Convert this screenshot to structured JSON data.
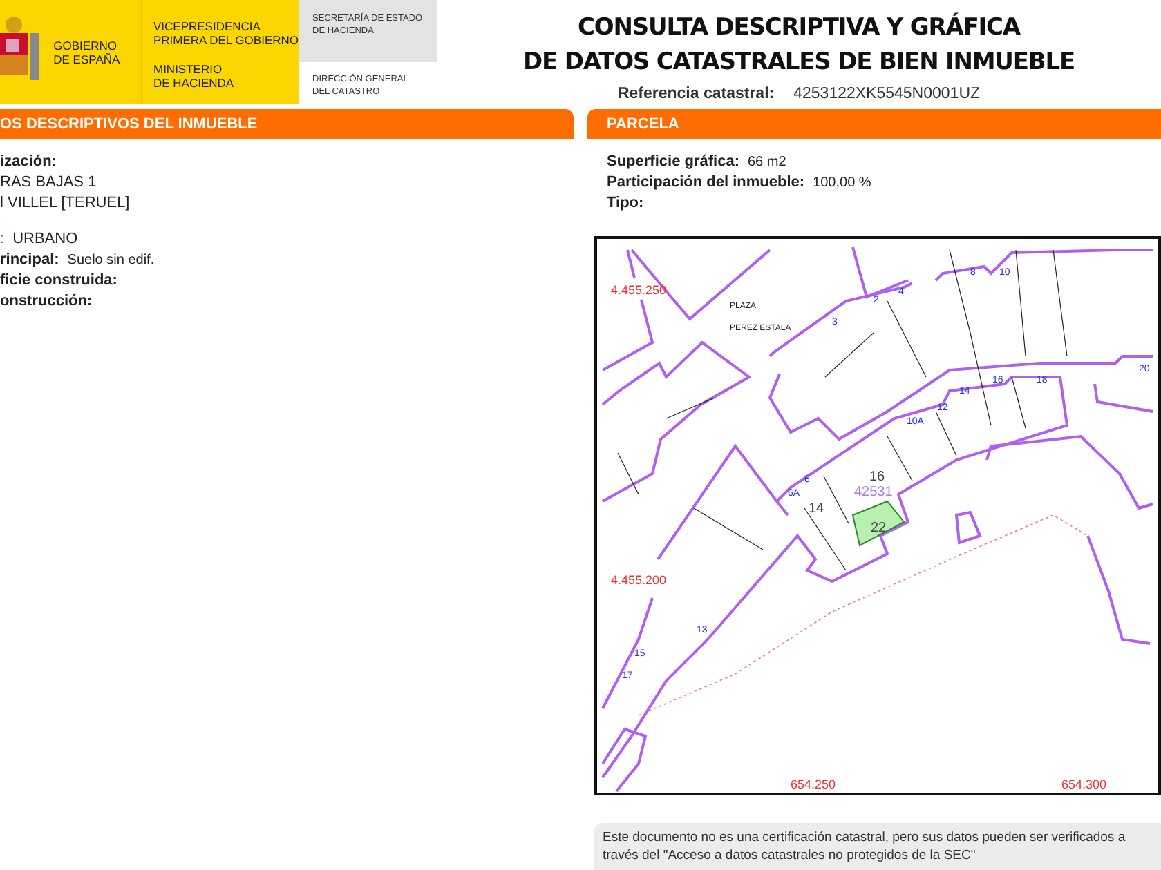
{
  "header": {
    "government": [
      "GOBIERNO",
      "DE ESPAÑA"
    ],
    "vicepresidency": [
      "VICEPRESIDENCIA",
      "PRIMERA DEL GOBIERNO"
    ],
    "ministry": [
      "MINISTERIO",
      "DE HACIENDA"
    ],
    "secretariat": [
      "SECRETARÍA DE ESTADO",
      "DE HACIENDA"
    ],
    "directorate": [
      "DIRECCIÓN GENERAL",
      "DEL CATASTRO"
    ]
  },
  "title": [
    "CONSULTA DESCRIPTIVA Y GRÁFICA",
    "DE DATOS CATASTRALES DE BIEN INMUEBLE"
  ],
  "reference": {
    "label": "Referencia catastral:",
    "value": "4253122XK5545N0001UZ"
  },
  "property": {
    "heading": "OS DESCRIPTIVOS DEL INMUEBLE",
    "location_label": "ización:",
    "address_lines": [
      "RAS BAJAS 1",
      "l VILLEL [TERUEL]"
    ],
    "fields": [
      {
        "label": ":",
        "value": "URBANO"
      },
      {
        "label": "rincipal:",
        "value": "Suelo sin edif."
      },
      {
        "label": "ficie construida:"
      },
      {
        "label": "onstrucción:"
      }
    ]
  },
  "parcel": {
    "heading": "PARCELA",
    "fields": [
      {
        "label": "Superficie gráfica:",
        "value": "66 m2"
      },
      {
        "label": "Participación del inmueble:",
        "value": "100,00 %"
      },
      {
        "label": "Tipo:"
      }
    ],
    "map": {
      "labels": [
        {
          "kind": "coord",
          "text": "4.455.250"
        },
        {
          "kind": "coord",
          "text": "4.455.200"
        },
        {
          "kind": "coord",
          "text": "654.250"
        },
        {
          "kind": "coord",
          "text": "654.300"
        },
        {
          "kind": "street",
          "text": "PLAZA"
        },
        {
          "kind": "street",
          "text": "PEREZ ESTALA"
        },
        {
          "kind": "block",
          "text": "16"
        },
        {
          "kind": "block",
          "text": "14"
        },
        {
          "kind": "parcel",
          "text": "42531"
        },
        {
          "kind": "block",
          "text": "22"
        },
        {
          "kind": "house",
          "text": "3"
        },
        {
          "kind": "house",
          "text": "2"
        },
        {
          "kind": "house",
          "text": "4"
        },
        {
          "kind": "house",
          "text": "8"
        },
        {
          "kind": "house",
          "text": "10"
        },
        {
          "kind": "house",
          "text": "14"
        },
        {
          "kind": "house",
          "text": "16"
        },
        {
          "kind": "house",
          "text": "18"
        },
        {
          "kind": "house",
          "text": "12"
        },
        {
          "kind": "house",
          "text": "10A"
        },
        {
          "kind": "house",
          "text": "6A"
        },
        {
          "kind": "house",
          "text": "6"
        },
        {
          "kind": "house",
          "text": "20"
        },
        {
          "kind": "house",
          "text": "13"
        },
        {
          "kind": "house",
          "text": "15"
        },
        {
          "kind": "house",
          "text": "17"
        }
      ]
    }
  },
  "note": "Este documento no es una certificación catastral, pero sus datos pueden ser verificados a través del \"Acceso a datos catastrales no protegidos de la SEC\""
}
